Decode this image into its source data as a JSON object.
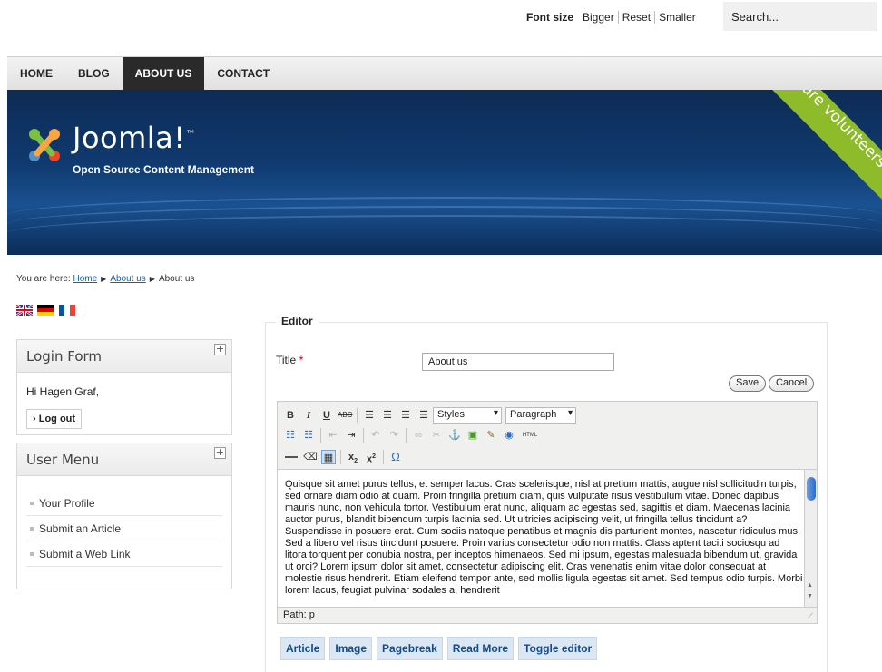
{
  "header": {
    "font_size_label": "Font size",
    "font_options": [
      "Bigger",
      "Reset",
      "Smaller"
    ],
    "search_placeholder": "Search..."
  },
  "nav": {
    "items": [
      "HOME",
      "BLOG",
      "ABOUT US",
      "CONTACT"
    ],
    "active": "ABOUT US"
  },
  "banner": {
    "brand": "Joomla!",
    "tm": "™",
    "tagline": "Open Source Content Management",
    "ribbon": "We are volunteers !"
  },
  "breadcrumb": {
    "prefix": "You are here:",
    "links": [
      "Home",
      "About us"
    ],
    "current": "About us"
  },
  "languages": [
    "en-icon",
    "de-icon",
    "fr-icon"
  ],
  "login_form": {
    "title": "Login Form",
    "greeting": "Hi Hagen Graf,",
    "logout": "Log out"
  },
  "user_menu": {
    "title": "User Menu",
    "items": [
      "Your Profile",
      "Submit an Article",
      "Submit a Web Link"
    ]
  },
  "editor": {
    "legend": "Editor",
    "title_label": "Title",
    "required_mark": "*",
    "title_value": "About us",
    "save": "Save",
    "cancel": "Cancel",
    "styles_select": "Styles",
    "format_select": "Paragraph",
    "path": "Path: p",
    "content": "Quisque sit amet purus tellus, et semper lacus. Cras scelerisque; nisl at pretium mattis; augue nisl sollicitudin turpis, sed ornare diam odio at quam. Proin fringilla pretium diam, quis vulputate risus vestibulum vitae. Donec dapibus mauris nunc, non vehicula tortor. Vestibulum erat nunc, aliquam ac egestas sed, sagittis et diam. Maecenas lacinia auctor purus, blandit bibendum turpis lacinia sed. Ut ultricies adipiscing velit, ut fringilla tellus tincidunt a? Suspendisse in posuere erat. Cum sociis natoque penatibus et magnis dis parturient montes, nascetur ridiculus mus. Sed a libero vel risus tincidunt posuere. Proin varius consectetur odio non mattis. Class aptent taciti sociosqu ad litora torquent per conubia nostra, per inceptos himenaeos. Sed mi ipsum, egestas malesuada bibendum ut, gravida ut orci? Lorem ipsum dolor sit amet, consectetur adipiscing elit. Cras venenatis enim vitae dolor consequat at molestie risus hendrerit. Etiam eleifend tempor ante, sed mollis ligula egestas sit amet. Sed tempus odio turpis. Morbi lorem lacus, feugiat pulvinar sodales a, hendrerit",
    "extra_buttons": [
      "Article",
      "Image",
      "Pagebreak",
      "Read More",
      "Toggle editor"
    ]
  },
  "colors": {
    "nav_active": "#2a2a2a",
    "banner": "#103a70",
    "ribbon": "#8dbb2a",
    "link": "#1a5fa8"
  }
}
